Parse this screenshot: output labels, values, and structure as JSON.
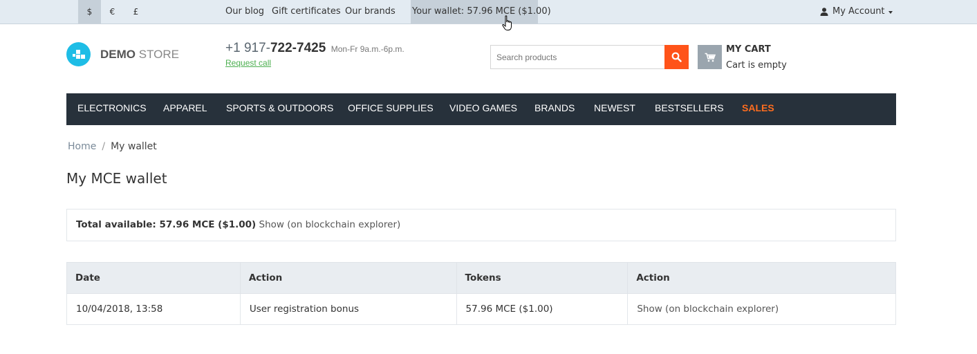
{
  "topbar": {
    "currencies": [
      {
        "label": "$",
        "active": true
      },
      {
        "label": "€",
        "active": false
      },
      {
        "label": "£",
        "active": false
      }
    ],
    "links": [
      "Our blog",
      "Gift certificates",
      "Our brands"
    ],
    "wallet": "Your wallet: 57.96 MCE ($1.00)",
    "account": "My Account"
  },
  "header": {
    "logo_bold": "DEMO",
    "logo_light": "STORE",
    "phone_prefix": "+1 917-",
    "phone_number": "722-7425",
    "hours": "Mon-Fr 9a.m.-6p.m.",
    "request_call": "Request call",
    "search_placeholder": "Search products",
    "cart_title": "MY CART",
    "cart_status": "Cart is empty"
  },
  "nav": [
    "ELECTRONICS",
    "APPAREL",
    "SPORTS & OUTDOORS",
    "OFFICE SUPPLIES",
    "VIDEO GAMES",
    "BRANDS",
    "NEWEST",
    "BESTSELLERS",
    "SALES"
  ],
  "breadcrumb": {
    "home": "Home",
    "separator": "/",
    "current": "My wallet"
  },
  "page_title": "My MCE wallet",
  "total": {
    "label": "Total available: 57.96 MCE ($1.00)",
    "link": "Show (on blockchain explorer)"
  },
  "table": {
    "headers": [
      "Date",
      "Action",
      "Tokens",
      "Action"
    ],
    "rows": [
      [
        "10/04/2018, 13:58",
        "User registration bonus",
        "57.96 MCE ($1.00)",
        "Show (on blockchain explorer)"
      ]
    ]
  },
  "colors": {
    "topbar_bg": "#e3ebf2",
    "nav_bg": "#27313b",
    "accent_orange": "#ff5319",
    "sales": "#ff6d1f",
    "logo_blue": "#1ebde6",
    "request_green": "#4caf50"
  }
}
